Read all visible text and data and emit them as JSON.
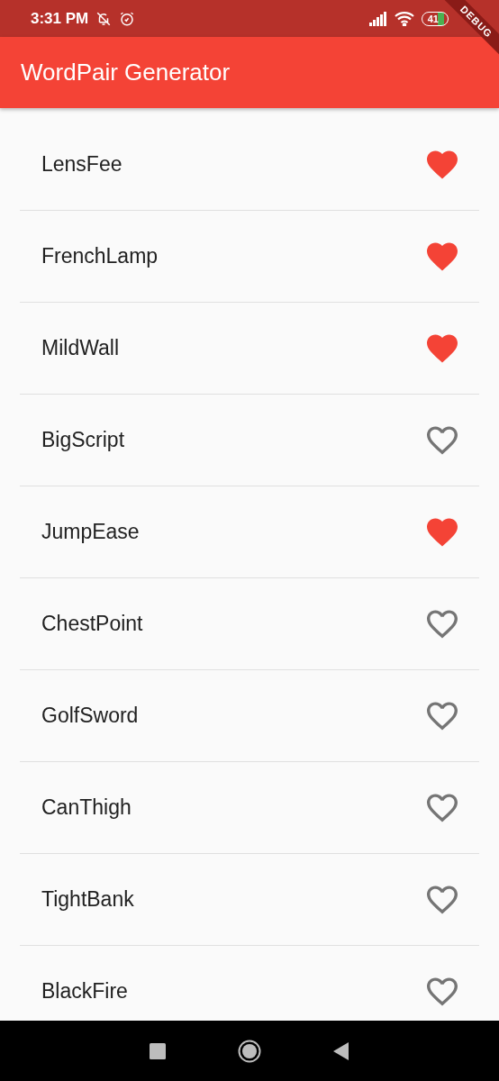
{
  "status_bar": {
    "time": "3:31 PM",
    "battery": "41"
  },
  "debug_banner": "DEBUG",
  "app_bar": {
    "title": "WordPair Generator"
  },
  "list": [
    {
      "label": "LensFee",
      "saved": true
    },
    {
      "label": "FrenchLamp",
      "saved": true
    },
    {
      "label": "MildWall",
      "saved": true
    },
    {
      "label": "BigScript",
      "saved": false
    },
    {
      "label": "JumpEase",
      "saved": true
    },
    {
      "label": "ChestPoint",
      "saved": false
    },
    {
      "label": "GolfSword",
      "saved": false
    },
    {
      "label": "CanThigh",
      "saved": false
    },
    {
      "label": "TightBank",
      "saved": false
    },
    {
      "label": "BlackFire",
      "saved": false
    }
  ]
}
